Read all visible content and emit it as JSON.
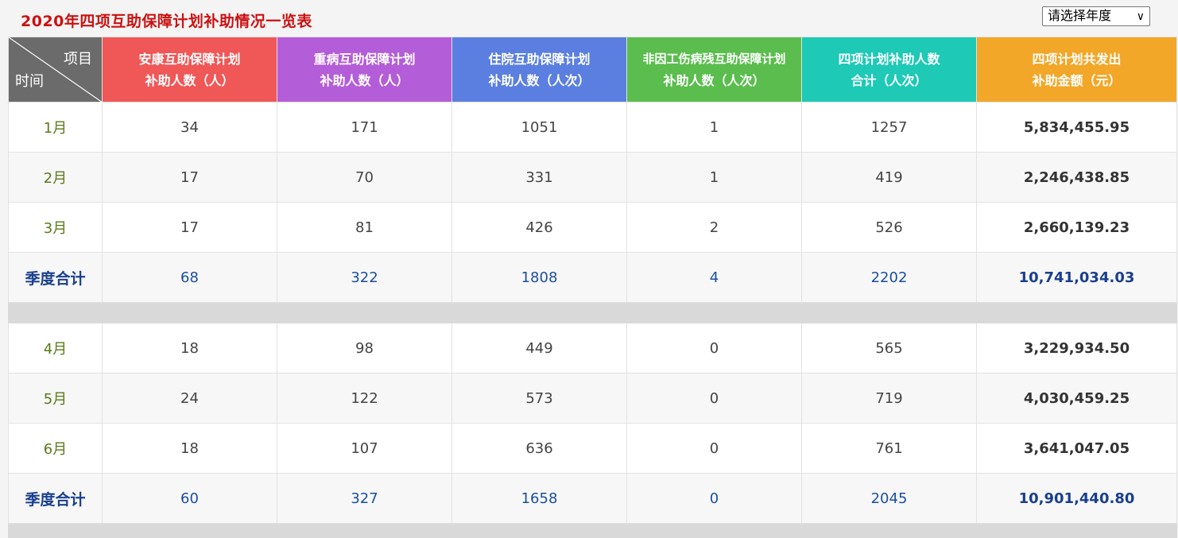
{
  "title": "2020年四项互助保障计划补助情况一览表",
  "year_select": {
    "label": "请选择年度",
    "icon": "chevron-down-icon"
  },
  "corner": {
    "top_right": "项目",
    "bottom_left": "时间"
  },
  "headers": [
    {
      "line1": "安康互助保障计划",
      "line2": "补助人数（人）",
      "color": "#f05757"
    },
    {
      "line1": "重病互助保障计划",
      "line2": "补助人数（人）",
      "color": "#b45dd8"
    },
    {
      "line1": "住院互助保障计划",
      "line2": "补助人数（人次）",
      "color": "#5a7fe0"
    },
    {
      "line1": "非因工伤病残互助保障计划",
      "line2": "补助人数（人次）",
      "color": "#5bbd4e"
    },
    {
      "line1": "四项计划补助人数",
      "line2": "合计（人次）",
      "color": "#1ec9b6"
    },
    {
      "line1": "四项计划共发出",
      "line2": "补助金额（元）",
      "color": "#f2a728"
    }
  ],
  "quarters": [
    {
      "months": [
        {
          "month": "1月",
          "values": [
            "34",
            "171",
            "1051",
            "1",
            "1257",
            "5,834,455.95"
          ]
        },
        {
          "month": "2月",
          "values": [
            "17",
            "70",
            "331",
            "1",
            "419",
            "2,246,438.85"
          ]
        },
        {
          "month": "3月",
          "values": [
            "17",
            "81",
            "426",
            "2",
            "526",
            "2,660,139.23"
          ]
        }
      ],
      "total": {
        "label": "季度合计",
        "values": [
          "68",
          "322",
          "1808",
          "4",
          "2202",
          "10,741,034.03"
        ]
      }
    },
    {
      "months": [
        {
          "month": "4月",
          "values": [
            "18",
            "98",
            "449",
            "0",
            "565",
            "3,229,934.50"
          ]
        },
        {
          "month": "5月",
          "values": [
            "24",
            "122",
            "573",
            "0",
            "719",
            "4,030,459.25"
          ]
        },
        {
          "month": "6月",
          "values": [
            "18",
            "107",
            "636",
            "0",
            "761",
            "3,641,047.05"
          ]
        }
      ],
      "total": {
        "label": "季度合计",
        "values": [
          "60",
          "327",
          "1658",
          "0",
          "2045",
          "10,901,440.80"
        ]
      }
    }
  ]
}
